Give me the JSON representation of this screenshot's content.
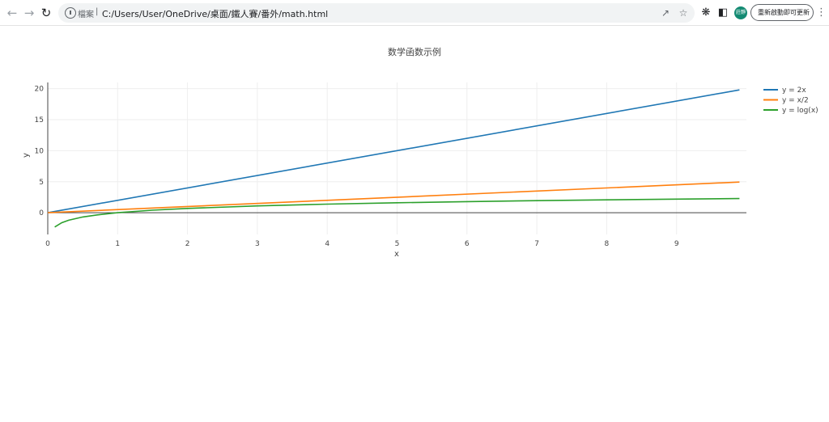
{
  "browser": {
    "url_scheme_label": "檔案",
    "url": "C:/Users/User/OneDrive/桌面/鐵人賽/番外/math.html",
    "profile_initials": "莊靜",
    "update_button_label": "重新啟動即可更新"
  },
  "icons": {
    "back": "arrow-left",
    "forward": "arrow-right",
    "reload": "reload",
    "info": "info-circle",
    "share": "share",
    "bookmark": "star",
    "extensions": "puzzle",
    "side_panel": "side-panel",
    "menu": "kebab-menu"
  },
  "chart_data": {
    "type": "line",
    "title": "数学函数示例",
    "xlabel": "x",
    "ylabel": "y",
    "xlim": [
      0,
      10
    ],
    "ylim": [
      -3.5,
      21
    ],
    "x_ticks": [
      0,
      1,
      2,
      3,
      4,
      5,
      6,
      7,
      8,
      9
    ],
    "y_ticks": [
      0,
      5,
      10,
      15,
      20
    ],
    "grid": true,
    "legend_position": "top-right",
    "series": [
      {
        "name": "y = 2x",
        "color": "#1f77b4",
        "x": [
          0,
          9.9
        ],
        "y": [
          0,
          19.8
        ]
      },
      {
        "name": "y = x/2",
        "color": "#ff7f0e",
        "x": [
          0,
          9.9
        ],
        "y": [
          0,
          4.95
        ]
      },
      {
        "name": "y = log(x)",
        "color": "#2ca02c",
        "x": [
          0.1,
          0.2,
          0.3,
          0.5,
          0.7,
          1,
          1.5,
          2,
          3,
          4,
          5,
          6,
          7,
          8,
          9,
          9.9
        ],
        "y": [
          -2.3,
          -1.61,
          -1.2,
          -0.69,
          -0.36,
          0,
          0.41,
          0.69,
          1.1,
          1.39,
          1.61,
          1.79,
          1.95,
          2.08,
          2.2,
          2.29
        ]
      }
    ]
  }
}
